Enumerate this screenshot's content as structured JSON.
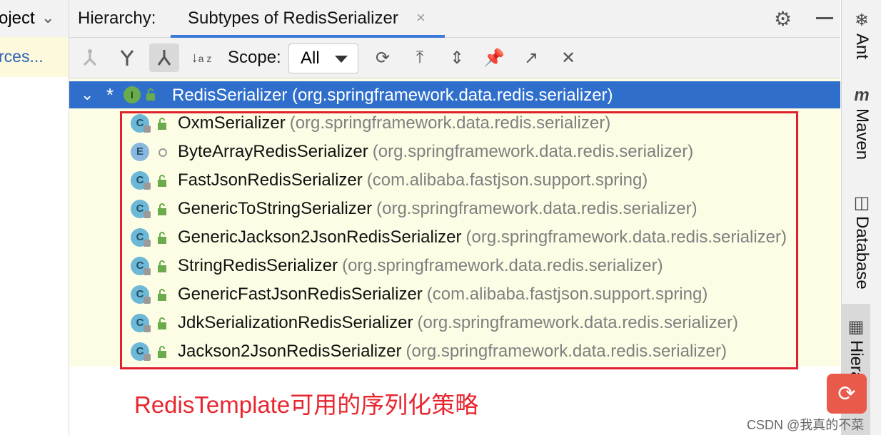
{
  "left": {
    "project_label": "oject",
    "sources_label": "rces..."
  },
  "tabbar": {
    "title": "Hierarchy:",
    "tab_label": "Subtypes of RedisSerializer",
    "close": "×"
  },
  "toolbar": {
    "scope_label": "Scope:",
    "scope_value": "All"
  },
  "tree": {
    "root": {
      "marker": "*",
      "icon": "I",
      "name": "RedisSerializer (org.springframework.data.redis.serializer)"
    },
    "items": [
      {
        "icon": "C",
        "class": "OxmSerializer",
        "package": "(org.springframework.data.redis.serializer)"
      },
      {
        "icon": "E",
        "class": "ByteArrayRedisSerializer",
        "package": "(org.springframework.data.redis.serializer)"
      },
      {
        "icon": "C",
        "class": "FastJsonRedisSerializer",
        "package": "(com.alibaba.fastjson.support.spring)"
      },
      {
        "icon": "C",
        "class": "GenericToStringSerializer",
        "package": "(org.springframework.data.redis.serializer)"
      },
      {
        "icon": "C",
        "class": "GenericJackson2JsonRedisSerializer",
        "package": "(org.springframework.data.redis.serializer)"
      },
      {
        "icon": "C",
        "class": "StringRedisSerializer",
        "package": "(org.springframework.data.redis.serializer)"
      },
      {
        "icon": "C",
        "class": "GenericFastJsonRedisSerializer",
        "package": "(com.alibaba.fastjson.support.spring)"
      },
      {
        "icon": "C",
        "class": "JdkSerializationRedisSerializer",
        "package": "(org.springframework.data.redis.serializer)"
      },
      {
        "icon": "C",
        "class": "Jackson2JsonRedisSerializer",
        "package": "(org.springframework.data.redis.serializer)"
      }
    ]
  },
  "annotation": {
    "caption": "RedisTemplate可用的序列化策略",
    "color": "#e0202a"
  },
  "rightbar": {
    "ant": "Ant",
    "maven_icon": "m",
    "maven": "Maven",
    "database": "Database",
    "hierarchy": "Hierarchy"
  },
  "watermark": "CSDN @我真的不菜",
  "colors": {
    "selection": "#2f6fcb",
    "tree_bg": "#fdfde6",
    "accent": "#3d7bd9"
  }
}
